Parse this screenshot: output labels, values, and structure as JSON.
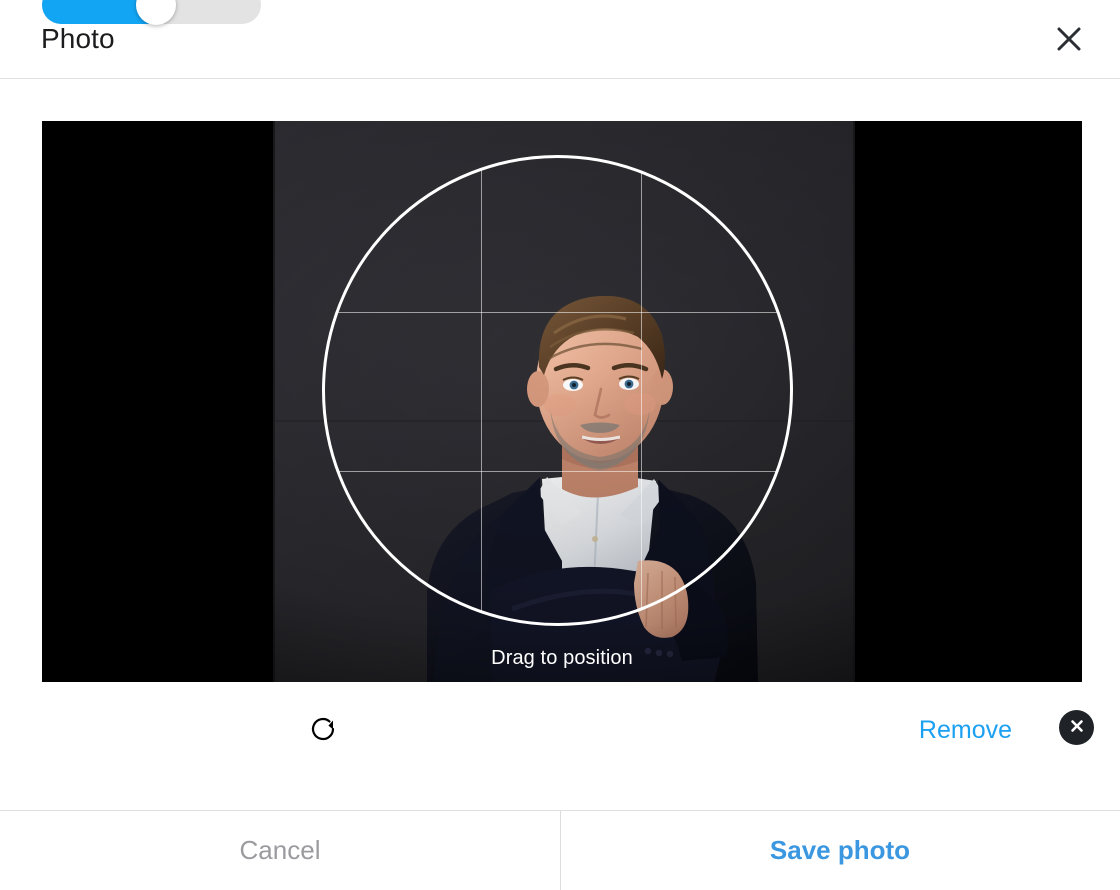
{
  "header": {
    "title": "Photo",
    "close_icon": "close-icon"
  },
  "editor": {
    "drag_hint": "Drag to position",
    "crop_shape": "circle",
    "grid": "rule-of-thirds",
    "background_color": "#000000",
    "photo_description": "Portrait of a smiling man with short brown hair and a short beard, wearing a dark navy suit jacket over a white open-collar shirt, arms crossed, against a dark charcoal wall"
  },
  "controls": {
    "zoom_slider": {
      "name": "zoom-slider",
      "value_percent": 52,
      "fill_color": "#12a5f4",
      "track_color": "#e3e3e3",
      "thumb_color": "#ffffff"
    },
    "rotate_icon": "rotate-clockwise-icon",
    "remove_label": "Remove",
    "remove_color": "#1ba0f2",
    "remove_x_icon": "close-circle-filled-icon"
  },
  "footer": {
    "cancel_label": "Cancel",
    "cancel_color": "#9b9b9f",
    "save_label": "Save photo",
    "save_color": "#3b97df"
  }
}
